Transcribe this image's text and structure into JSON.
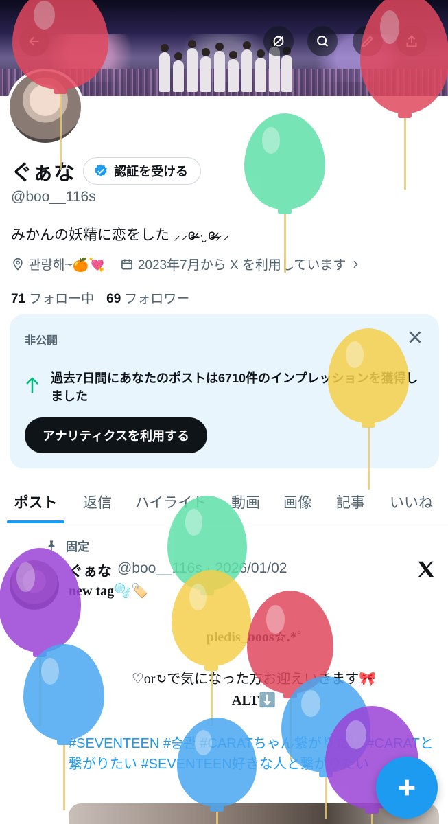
{
  "profile": {
    "name": "ぐぁな",
    "verify_label": "認証を受ける",
    "handle": "@boo__116s",
    "bio": "みかんの妖精に恋をした ⸝⸝ɞ̴̶̷ ·̮ ɞ̴̶̷⸝⸝",
    "location": "관랑해~🍊💘",
    "joined": "2023年7月から X を利用しています",
    "following_count": "71",
    "following_label": "フォロー中",
    "followers_count": "69",
    "followers_label": "フォロワー"
  },
  "card": {
    "label": "非公開",
    "text": "過去7日間にあなたのポストは6710件のインプレッションを獲得しました",
    "button": "アナリティクスを利用する"
  },
  "tabs": [
    "ポスト",
    "返信",
    "ハイライト",
    "動画",
    "画像",
    "記事",
    "いいね"
  ],
  "post": {
    "pinned_label": "固定",
    "author": "ぐぁな",
    "meta": "@boo__116s · 2026/01/02",
    "line1": "new tag🫧🏷️",
    "line2": "pledis_boos☆.*˚",
    "line3": "♡or↻で気になった方お迎えいきます🎀",
    "line4": "ALT⬇️",
    "hashtags": "#SEVENTEEN #승관 #CARATちゃん繋がりたい #CARATと繋がりたい #SEVENTEEN好きな人と繋がりたい"
  },
  "icons": {
    "back": "back-arrow-icon",
    "no_location": "crossed-circle-icon",
    "search": "search-icon",
    "edit": "pen-icon",
    "share": "share-icon",
    "verified": "verified-badge-icon",
    "location": "location-pin-icon",
    "calendar": "calendar-icon",
    "close": "close-icon",
    "arrow_up": "arrow-up-icon",
    "pin": "pin-icon",
    "x_logo": "x-logo-icon",
    "compose": "plus-icon"
  },
  "colors": {
    "accent": "#1d9bf0",
    "card_bg": "#e8f5fd",
    "growth": "#00ba7c",
    "balloon_red": "#e0485e",
    "balloon_green": "#5fe0a8",
    "balloon_yellow": "#f5d04c",
    "balloon_blue": "#4aa6f0",
    "balloon_purple": "#9b44d6"
  }
}
